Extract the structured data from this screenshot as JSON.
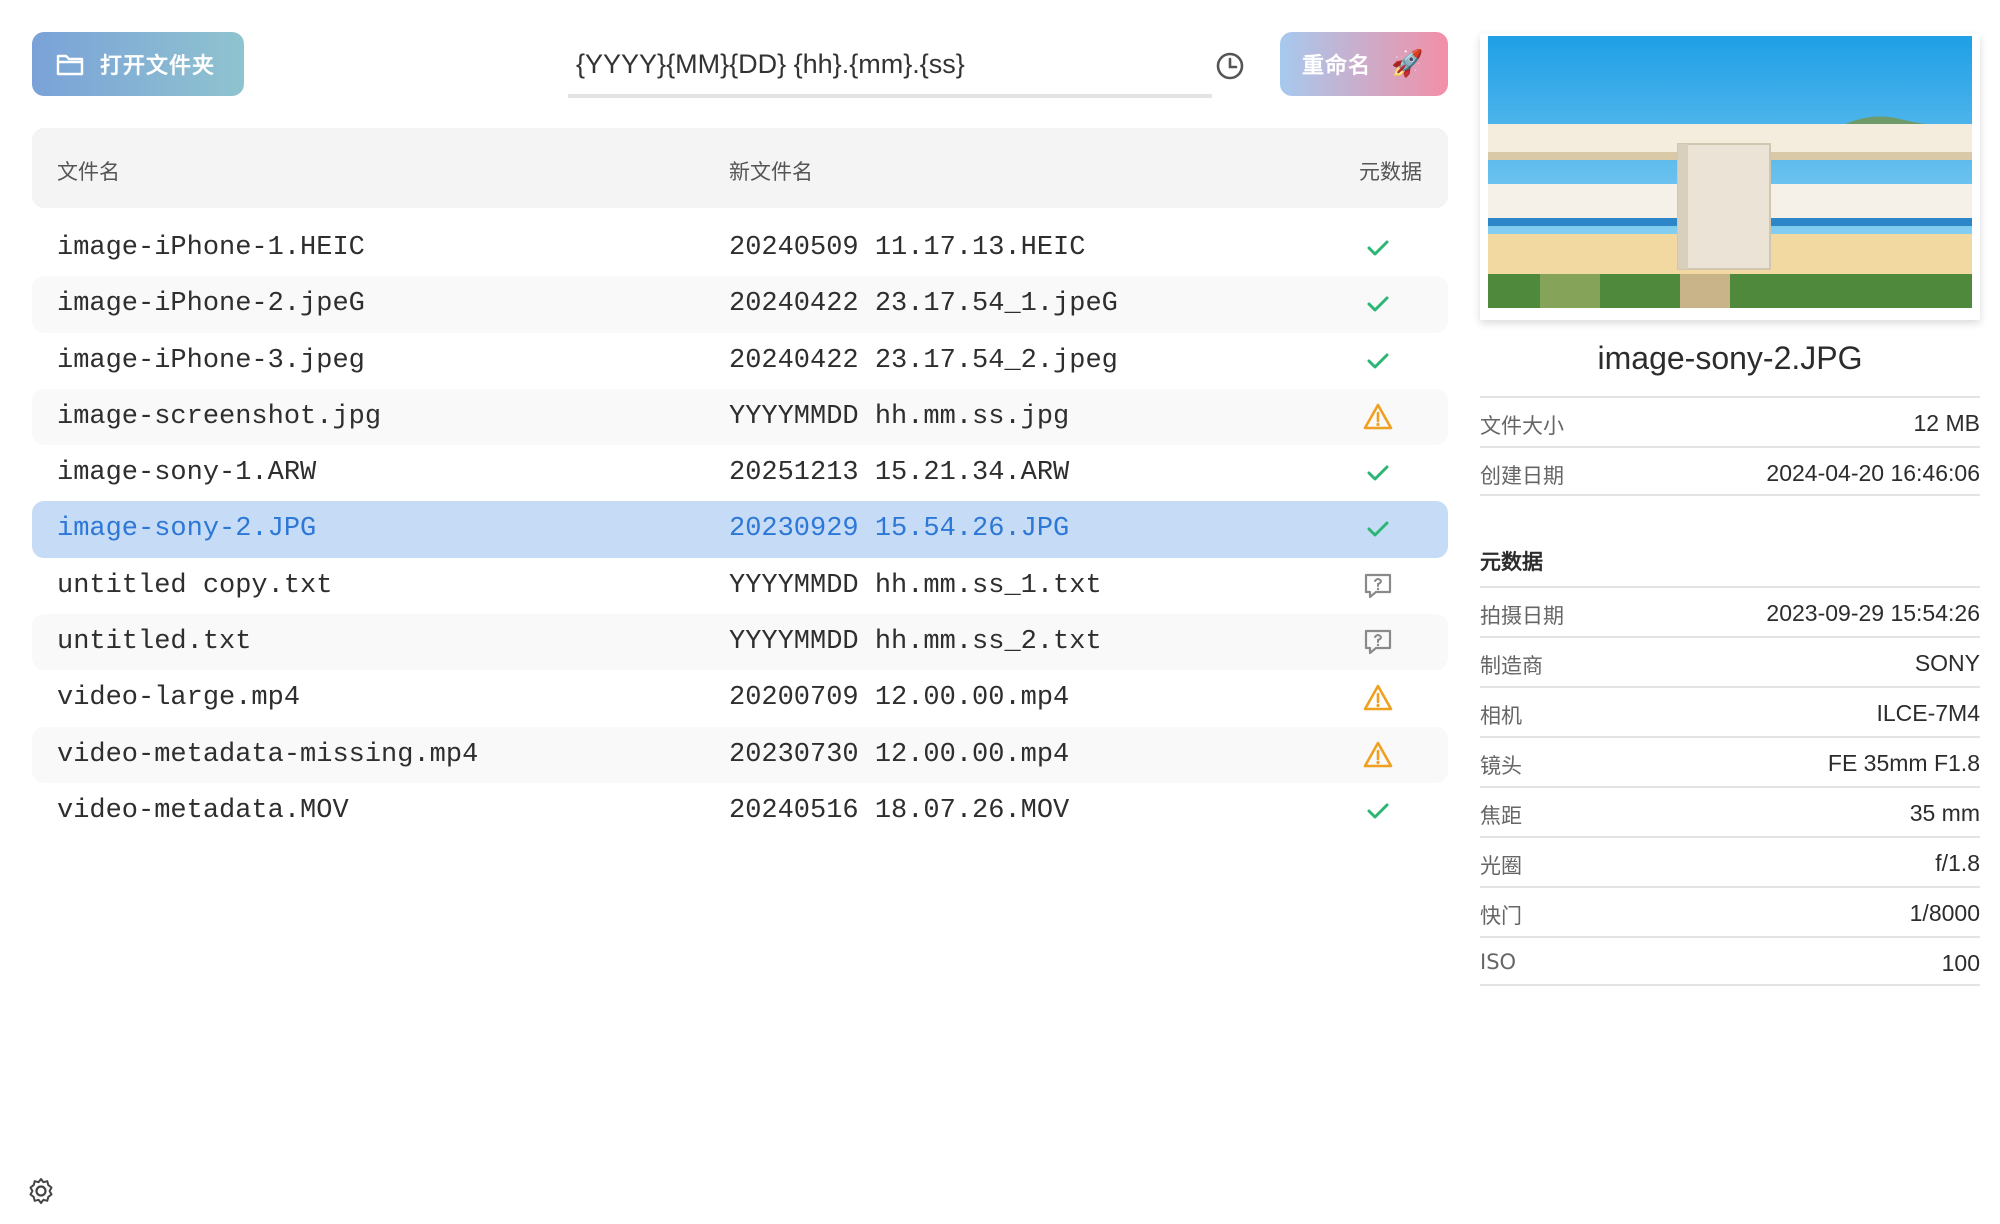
{
  "toolbar": {
    "open_folder_label": "打开文件夹",
    "pattern_value": "{YYYY}{MM}{DD} {hh}.{mm}.{ss}",
    "rename_label": "重命名",
    "rename_icon": "rocket-icon"
  },
  "table": {
    "headers": {
      "name": "文件名",
      "new_name": "新文件名",
      "metadata": "元数据"
    },
    "rows": [
      {
        "name": "image-iPhone-1.HEIC",
        "new_name": "20240509 11.17.13.HEIC",
        "status": "ok"
      },
      {
        "name": "image-iPhone-2.jpeG",
        "new_name": "20240422 23.17.54_1.jpeG",
        "status": "ok"
      },
      {
        "name": "image-iPhone-3.jpeg",
        "new_name": "20240422 23.17.54_2.jpeg",
        "status": "ok"
      },
      {
        "name": "image-screenshot.jpg",
        "new_name": "YYYYMMDD hh.mm.ss.jpg",
        "status": "warning"
      },
      {
        "name": "image-sony-1.ARW",
        "new_name": "20251213 15.21.34.ARW",
        "status": "ok"
      },
      {
        "name": "image-sony-2.JPG",
        "new_name": "20230929 15.54.26.JPG",
        "status": "ok",
        "selected": true
      },
      {
        "name": "untitled copy.txt",
        "new_name": "YYYYMMDD hh.mm.ss_1.txt",
        "status": "unknown"
      },
      {
        "name": "untitled.txt",
        "new_name": "YYYYMMDD hh.mm.ss_2.txt",
        "status": "unknown"
      },
      {
        "name": "video-large.mp4",
        "new_name": "20200709 12.00.00.mp4",
        "status": "warning"
      },
      {
        "name": "video-metadata-missing.mp4",
        "new_name": "20230730 12.00.00.mp4",
        "status": "warning"
      },
      {
        "name": "video-metadata.MOV",
        "new_name": "20240516 18.07.26.MOV",
        "status": "ok"
      }
    ]
  },
  "details": {
    "file_title": "image-sony-2.JPG",
    "file_info": [
      {
        "key": "文件大小",
        "value": "12 MB"
      },
      {
        "key": "创建日期",
        "value": "2024-04-20 16:46:06"
      }
    ],
    "metadata_title": "元数据",
    "metadata": [
      {
        "key": "拍摄日期",
        "value": "2023-09-29 15:54:26"
      },
      {
        "key": "制造商",
        "value": "SONY"
      },
      {
        "key": "相机",
        "value": "ILCE-7M4"
      },
      {
        "key": "镜头",
        "value": "FE 35mm F1.8"
      },
      {
        "key": "焦距",
        "value": "35 mm"
      },
      {
        "key": "光圈",
        "value": "f/1.8"
      },
      {
        "key": "快门",
        "value": "1/8000"
      },
      {
        "key": "ISO",
        "value": "100"
      }
    ]
  },
  "colors": {
    "ok": "#2bb673",
    "warning": "#f0a020",
    "unknown": "#8a8a8a",
    "selected_text": "#2d77d6"
  }
}
